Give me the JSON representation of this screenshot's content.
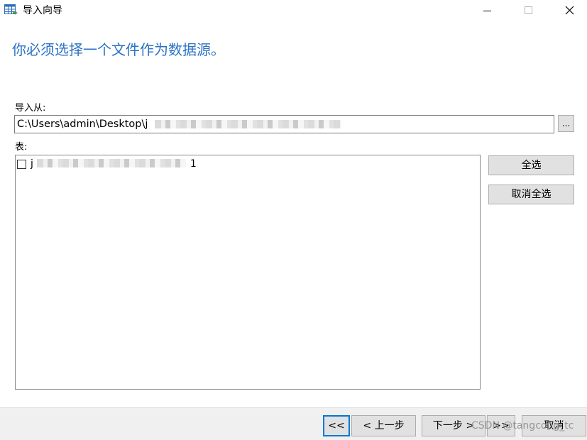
{
  "window": {
    "title": "导入向导",
    "icon": "table-import-icon",
    "controls": {
      "minimize": "minimize-icon",
      "maximize": "maximize-icon",
      "close": "close-icon"
    }
  },
  "heading": "你必须选择一个文件作为数据源。",
  "import_from": {
    "label": "导入从:",
    "value": "C:\\Users\\admin\\Desktop\\j",
    "browse_label": "..."
  },
  "tables": {
    "label": "表:",
    "items": [
      {
        "name_start": "j",
        "name_end": "1",
        "checked": false
      }
    ]
  },
  "side_buttons": {
    "select_all": "全选",
    "deselect_all": "取消全选"
  },
  "footer": {
    "first": "<<",
    "prev": "< 上一步",
    "next": "下一步 >",
    "last": ">>",
    "cancel": "取消",
    "watermark": "CSDN @tangcong_tc"
  },
  "colors": {
    "heading": "#2a72c4",
    "focus": "#0078d7",
    "button_face": "#e1e1e1"
  }
}
